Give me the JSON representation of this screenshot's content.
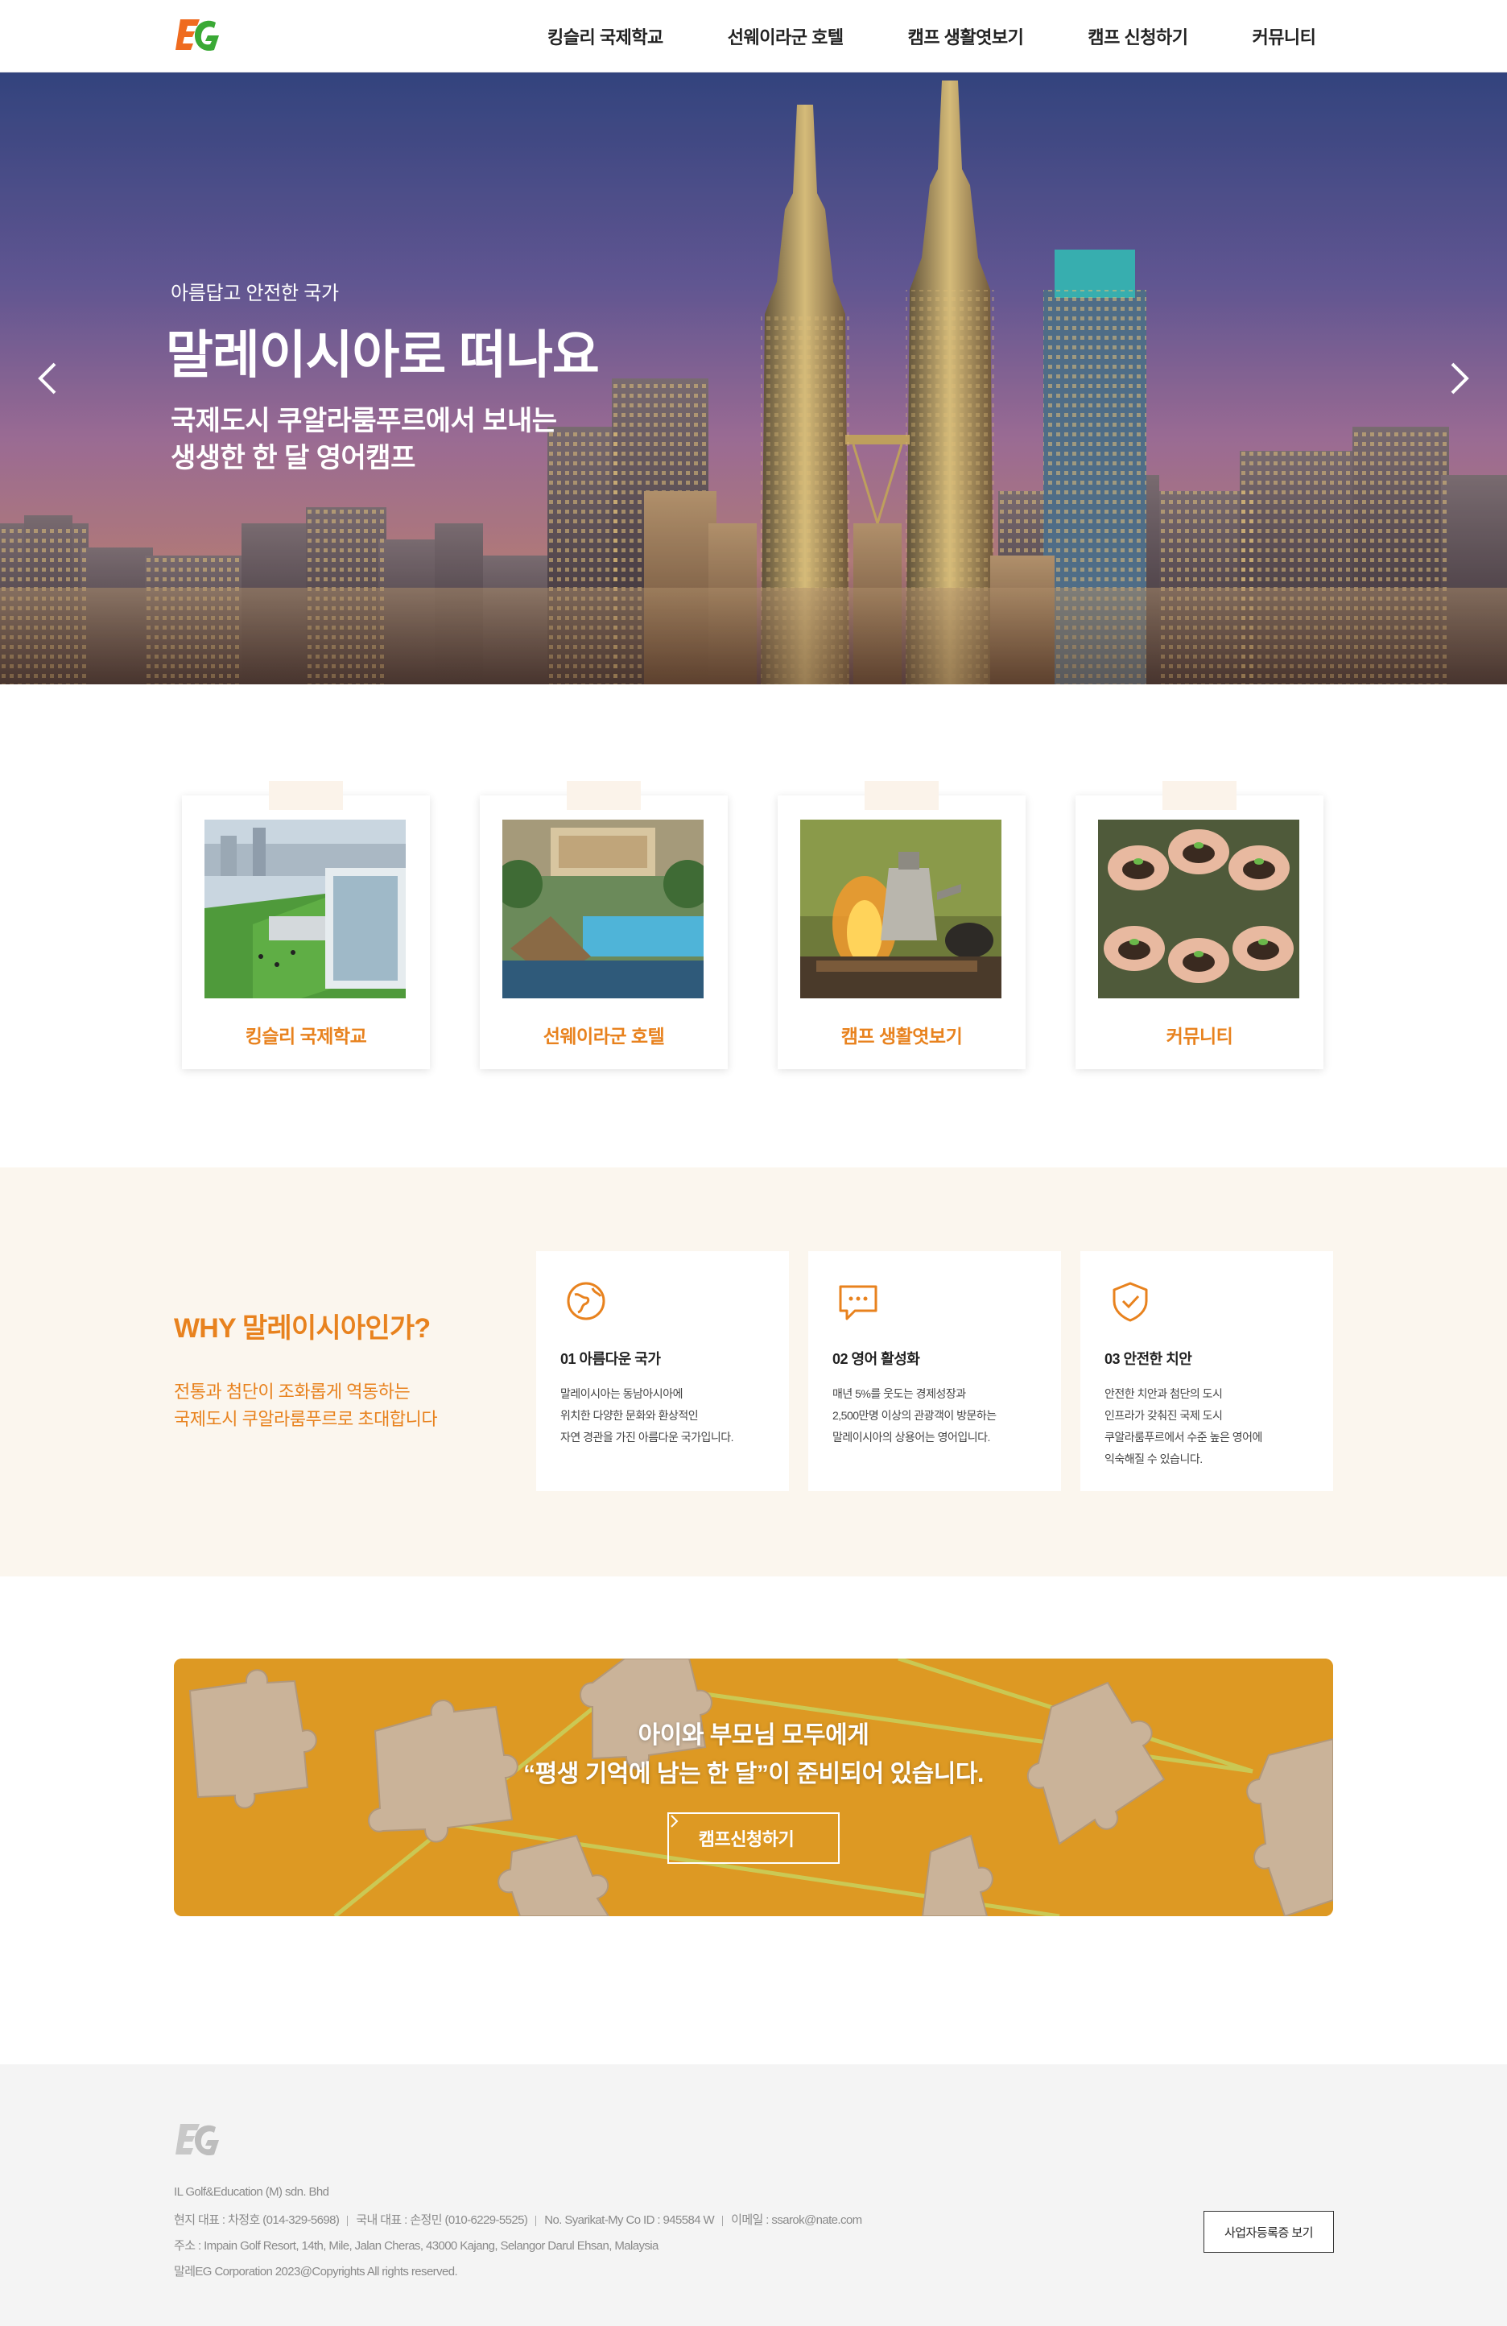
{
  "header": {
    "logo_text": "EG",
    "nav": [
      "킹슬리 국제학교",
      "선웨이라군 호텔",
      "캠프 생활엿보기",
      "캠프 신청하기",
      "커뮤니티"
    ]
  },
  "hero": {
    "eyebrow": "아름답고 안전한 국가",
    "title": "말레이시아로 떠나요",
    "subtitle_line1": "국제도시 쿠알라룸푸르에서 보내는",
    "subtitle_line2": "생생한 한 달 영어캠프",
    "prev_icon": "chevron-left-icon",
    "next_icon": "chevron-right-icon"
  },
  "cards": [
    {
      "label": "킹슬리 국제학교",
      "image": "school-campus-photo"
    },
    {
      "label": "선웨이라군 호텔",
      "image": "lagoon-resort-photo"
    },
    {
      "label": "캠프 생활엿보기",
      "image": "campfire-kettle-photo"
    },
    {
      "label": "커뮤니티",
      "image": "hands-seedlings-photo"
    }
  ],
  "why": {
    "heading": "WHY 말레이시아인가?",
    "desc_line1": "전통과 첨단이 조화롭게 역동하는",
    "desc_line2": "국제도시 쿠알라룸푸르로 초대합니다",
    "features": [
      {
        "icon": "globe-icon",
        "title": "01 아름다운 국가",
        "lines": [
          "말레이시아는 동남아시아에",
          "위치한 다양한 문화와 환상적인",
          "자연 경관을 가진 아름다운 국가입니다."
        ]
      },
      {
        "icon": "chat-bubble-icon",
        "title": "02 영어 활성화",
        "lines": [
          "매년 5%를 웃도는 경제성장과",
          "2,500만명 이상의 관광객이 방문하는",
          "말레이시아의 상용어는 영어입니다."
        ]
      },
      {
        "icon": "shield-check-icon",
        "title": "03 안전한 치안",
        "lines": [
          "안전한 치안과 첨단의 도시",
          "인프라가 갖춰진 국제 도시",
          "쿠알라룸푸르에서 수준 높은 영어에",
          "익숙해질 수 있습니다."
        ]
      }
    ]
  },
  "banner": {
    "line1": "아이와 부모님 모두에게",
    "line2": "“평생 기억에 남는 한 달”이 준비되어 있습니다.",
    "button_label": "캠프신청하기",
    "button_icon": "chevron-right-icon"
  },
  "footer": {
    "logo_text": "EG",
    "company": "IL Golf&Education (M) sdn. Bhd",
    "contacts": [
      "현지 대표 : 차정호 (014-329-5698)",
      "국내 대표 : 손정민 (010-6229-5525)",
      "No. Syarikat-My Co ID : 945584 W",
      "이메일 : ssarok@nate.com"
    ],
    "address": "주소 : Impain Golf Resort, 14th, Mile, Jalan Cheras, 43000 Kajang, Selangor Darul Ehsan, Malaysia",
    "copyright": "말레EG Corporation 2023@Copyrights All rights reserved.",
    "reg_button": "사업자등록증 보기"
  },
  "colors": {
    "accent": "#e8821e",
    "logo_green": "#3aa935",
    "logo_orange": "#ef6b1f",
    "why_bg": "#fbf6ee",
    "banner_bg": "#f2a928",
    "footer_bg": "#f4f4f4"
  }
}
